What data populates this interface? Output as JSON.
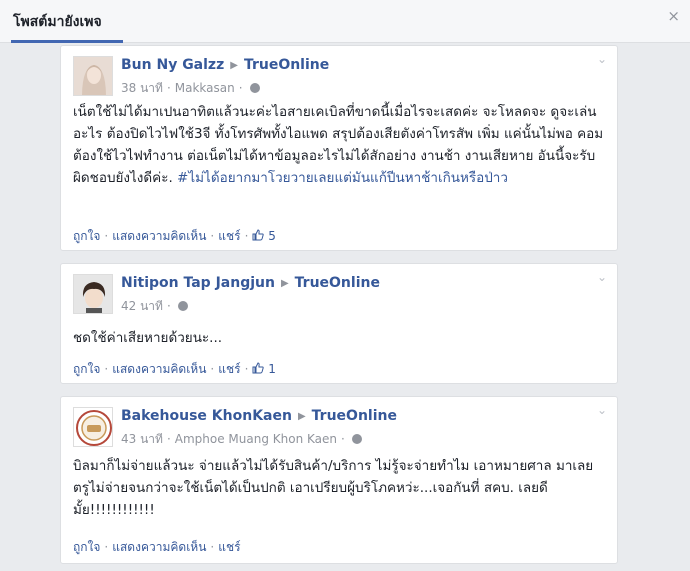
{
  "header": {
    "title": "โพสต์มายังเพจ",
    "close": "×"
  },
  "posts": [
    {
      "author": "Bun Ny Galzz",
      "page": "TrueOnline",
      "time": "38 นาที",
      "location": "Makkasan",
      "text": "เน็ตใช้ไม่ได้มาเปนอาทิตแล้วนะค่ะไอสายเคเบิลที่ขาดนี้เมื่อไรจะเสดค่ะ จะโหลดจะ ดูจะเล่นอะไร ต้องปิดไวไฟใช้3จี ทั้งโทรศัพทั้งไอแพด สรุปต้องเสียตังค่าโทรสัพ เพิ่ม แค่นั้นไม่พอ คอมต้องใช้ไวไฟทำงาน ต่อเน็ตไม่ได้หาข้อมูลอะไรไม่ได้สักอย่าง งานช้า งานเสียหาย อันนี้จะรับผิดชอบยังไงดีค่ะ. ",
      "hashtag": "#ไม่ได้อยากมาโวยวายเลยแต่มันแก้ปีนหาช้าเกินหรือป่าว",
      "like": "ถูกใจ",
      "comment": "แสดงความคิดเห็น",
      "share": "แชร์",
      "likes": "5"
    },
    {
      "author": "Nitipon Tap Jangjun",
      "page": "TrueOnline",
      "time": "42 นาที",
      "text": "ชดใช้ค่าเสียหายด้วยนะ...",
      "like": "ถูกใจ",
      "comment": "แสดงความคิดเห็น",
      "share": "แชร์",
      "likes": "1"
    },
    {
      "author": "Bakehouse KhonKaen",
      "page": "TrueOnline",
      "time": "43 นาที",
      "location": "Amphoe Muang Khon Kaen",
      "text": "บิลมาก็ไม่จ่ายแล้วนะ จ่ายแล้วไม่ได้รับสินค้า/บริการ ไม่รู้จะจ่ายทำไม เอาหมายศาล มาเลยตรูไม่จ่ายจนกว่าจะใช้เน็ตได้เป็นปกติ เอาเปรียบผู้บริโภคหว่ะ...เจอกันที่ สคบ. เลยดีมั้ย!!!!!!!!!!!!",
      "like": "ถูกใจ",
      "comment": "แสดงความคิดเห็น",
      "share": "แชร์"
    }
  ],
  "colors": {
    "link": "#365899",
    "accent": "#4267b2",
    "meta": "#90949c"
  }
}
